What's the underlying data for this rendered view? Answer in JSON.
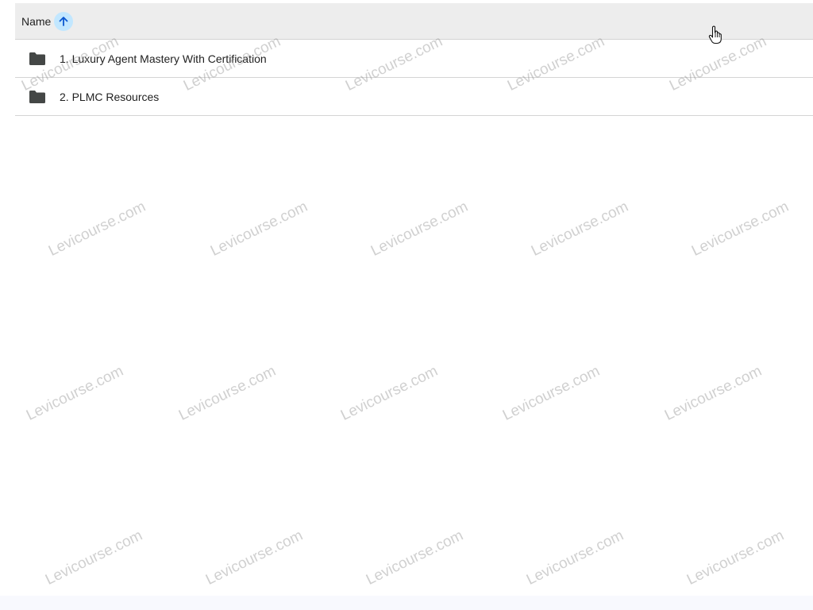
{
  "header": {
    "name_label": "Name"
  },
  "rows": [
    {
      "label": "1. Luxury Agent Mastery With Certification",
      "icon": "folder-icon"
    },
    {
      "label": "2. PLMC Resources",
      "icon": "folder-icon"
    }
  ],
  "watermark": {
    "text": "Levicourse.com"
  },
  "colors": {
    "header_bg": "#ededed",
    "sort_accent": "#c2e7ff",
    "sort_arrow": "#0b57d0",
    "folder": "#444746",
    "text": "#1f1f1f"
  }
}
